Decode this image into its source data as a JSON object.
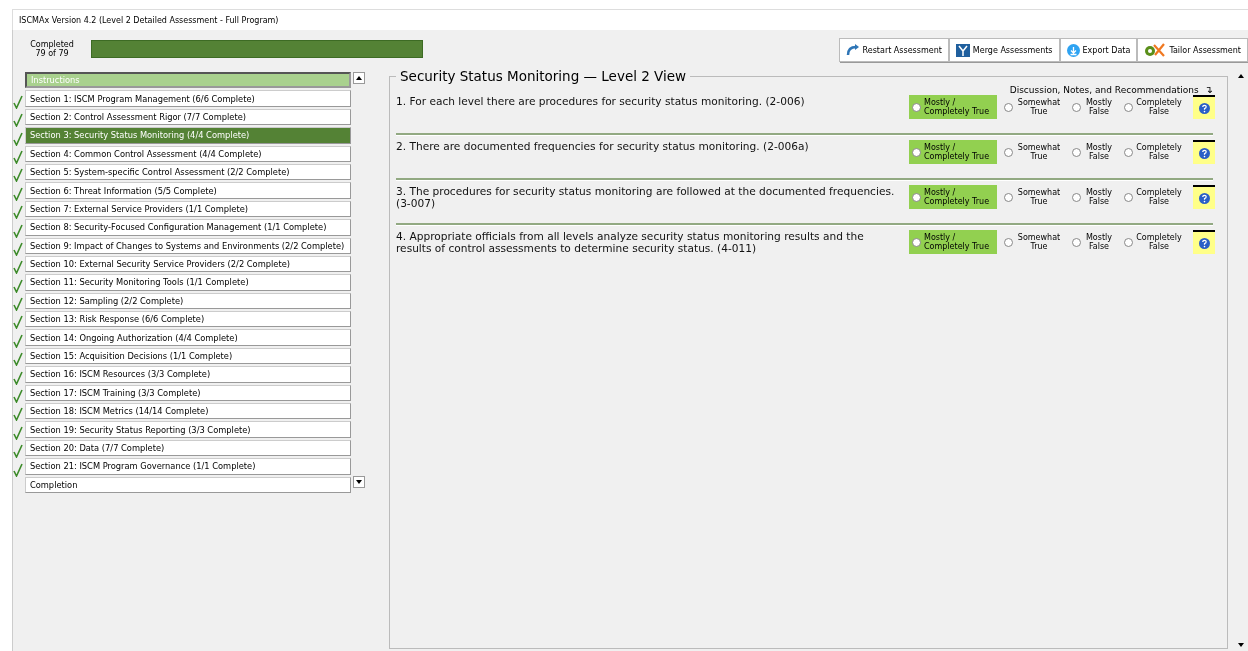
{
  "window": {
    "title": "ISCMAx Version 4.2 (Level 2 Detailed Assessment - Full Program)"
  },
  "progress": {
    "label": "Completed",
    "count": "79 of 79",
    "level": 1
  },
  "toolbar": [
    {
      "kind": "restart",
      "label": "Restart Assessment"
    },
    {
      "kind": "merge",
      "label": "Merge Assessments"
    },
    {
      "kind": "export",
      "label": "Export Data"
    },
    {
      "kind": "tailor",
      "label": "Tailor Assessment"
    }
  ],
  "sidebar": {
    "items": [
      {
        "kind": "instructions",
        "label": "Instructions",
        "selected": false,
        "complete": false
      },
      {
        "kind": "section",
        "label": "Section 1: ISCM Program Management (6/6 Complete)",
        "selected": false,
        "complete": true
      },
      {
        "kind": "section",
        "label": "Section 2: Control Assessment Rigor (7/7 Complete)",
        "selected": false,
        "complete": true
      },
      {
        "kind": "section",
        "label": "Section 3: Security Status Monitoring (4/4 Complete)",
        "selected": true,
        "complete": true
      },
      {
        "kind": "section",
        "label": "Section 4: Common Control Assessment (4/4 Complete)",
        "selected": false,
        "complete": true
      },
      {
        "kind": "section",
        "label": "Section 5: System-specific Control Assessment (2/2 Complete)",
        "selected": false,
        "complete": true
      },
      {
        "kind": "section",
        "label": "Section 6: Threat Information (5/5 Complete)",
        "selected": false,
        "complete": true
      },
      {
        "kind": "section",
        "label": "Section 7: External Service Providers (1/1 Complete)",
        "selected": false,
        "complete": true
      },
      {
        "kind": "section",
        "label": "Section 8: Security-Focused Configuration Management (1/1 Complete)",
        "selected": false,
        "complete": true
      },
      {
        "kind": "section",
        "label": "Section 9: Impact of Changes to Systems and Environments (2/2 Complete)",
        "selected": false,
        "complete": true
      },
      {
        "kind": "section",
        "label": "Section 10: External Security Service Providers (2/2 Complete)",
        "selected": false,
        "complete": true
      },
      {
        "kind": "section",
        "label": "Section 11: Security Monitoring Tools (1/1 Complete)",
        "selected": false,
        "complete": true
      },
      {
        "kind": "section",
        "label": "Section 12: Sampling (2/2 Complete)",
        "selected": false,
        "complete": true
      },
      {
        "kind": "section",
        "label": "Section 13: Risk Response (6/6 Complete)",
        "selected": false,
        "complete": true
      },
      {
        "kind": "section",
        "label": "Section 14: Ongoing Authorization (4/4 Complete)",
        "selected": false,
        "complete": true
      },
      {
        "kind": "section",
        "label": "Section 15: Acquisition Decisions (1/1 Complete)",
        "selected": false,
        "complete": true
      },
      {
        "kind": "section",
        "label": "Section 16: ISCM Resources (3/3 Complete)",
        "selected": false,
        "complete": true
      },
      {
        "kind": "section",
        "label": "Section 17: ISCM Training (3/3 Complete)",
        "selected": false,
        "complete": true
      },
      {
        "kind": "section",
        "label": "Section 18: ISCM Metrics (14/14 Complete)",
        "selected": false,
        "complete": true
      },
      {
        "kind": "section",
        "label": "Section 19: Security Status Reporting (3/3 Complete)",
        "selected": false,
        "complete": true
      },
      {
        "kind": "section",
        "label": "Section 20: Data (7/7 Complete)",
        "selected": false,
        "complete": true
      },
      {
        "kind": "section",
        "label": "Section 21: ISCM Program Governance (1/1 Complete)",
        "selected": false,
        "complete": true
      },
      {
        "kind": "completion",
        "label": "Completion",
        "selected": false,
        "complete": false
      }
    ]
  },
  "panel": {
    "title": "Security Status Monitoring — Level 2 View",
    "notes_heading": "Discussion, Notes, and Recommendations",
    "notes_marker": "↴",
    "questions": [
      {
        "text": "1. For each level there are procedures for security status monitoring. (2-006)",
        "options": [
          {
            "label": "Mostly / Completely True",
            "selected": true
          },
          {
            "label": "Somewhat True",
            "selected": false
          },
          {
            "label": "Mostly False",
            "selected": false
          },
          {
            "label": "Completely False",
            "selected": false
          }
        ]
      },
      {
        "text": "2. There are documented frequencies for security status monitoring. (2-006a)",
        "options": [
          {
            "label": "Mostly / Completely True",
            "selected": true
          },
          {
            "label": "Somewhat True",
            "selected": false
          },
          {
            "label": "Mostly False",
            "selected": false
          },
          {
            "label": "Completely False",
            "selected": false
          }
        ]
      },
      {
        "text": "3. The procedures for security status monitoring are followed at the documented frequencies. (3-007)",
        "options": [
          {
            "label": "Mostly / Completely True",
            "selected": true
          },
          {
            "label": "Somewhat True",
            "selected": false
          },
          {
            "label": "Mostly False",
            "selected": false
          },
          {
            "label": "Completely False",
            "selected": false
          }
        ]
      },
      {
        "text": "4. Appropriate officials from all levels analyze security status monitoring results and the results of control assessments to determine security status. (4-011)",
        "options": [
          {
            "label": "Mostly / Completely True",
            "selected": true
          },
          {
            "label": "Somewhat True",
            "selected": false
          },
          {
            "label": "Mostly False",
            "selected": false
          },
          {
            "label": "Completely False",
            "selected": false
          }
        ]
      }
    ]
  }
}
